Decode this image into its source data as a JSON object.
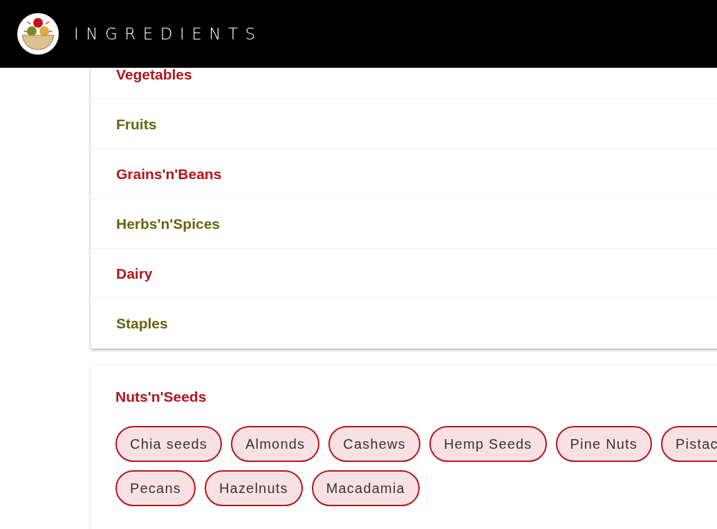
{
  "header": {
    "title": "INGREDIENTS"
  },
  "categories": [
    {
      "label": "Vegetables",
      "color": "#b5121b"
    },
    {
      "label": "Fruits",
      "color": "#65650c"
    },
    {
      "label": "Grains'n'Beans",
      "color": "#b5121b"
    },
    {
      "label": "Herbs'n'Spices",
      "color": "#65650c"
    },
    {
      "label": "Dairy",
      "color": "#b5121b"
    },
    {
      "label": "Staples",
      "color": "#65650c"
    }
  ],
  "open_category": {
    "label": "Nuts'n'Seeds",
    "color": "#b5121b",
    "chip_rows": [
      [
        "Chia seeds",
        "Almonds",
        "Cashews",
        "Hemp Seeds",
        "Pine Nuts",
        "Pistac"
      ],
      [
        "Pecans",
        "Hazelnuts",
        "Macadamia"
      ]
    ]
  }
}
